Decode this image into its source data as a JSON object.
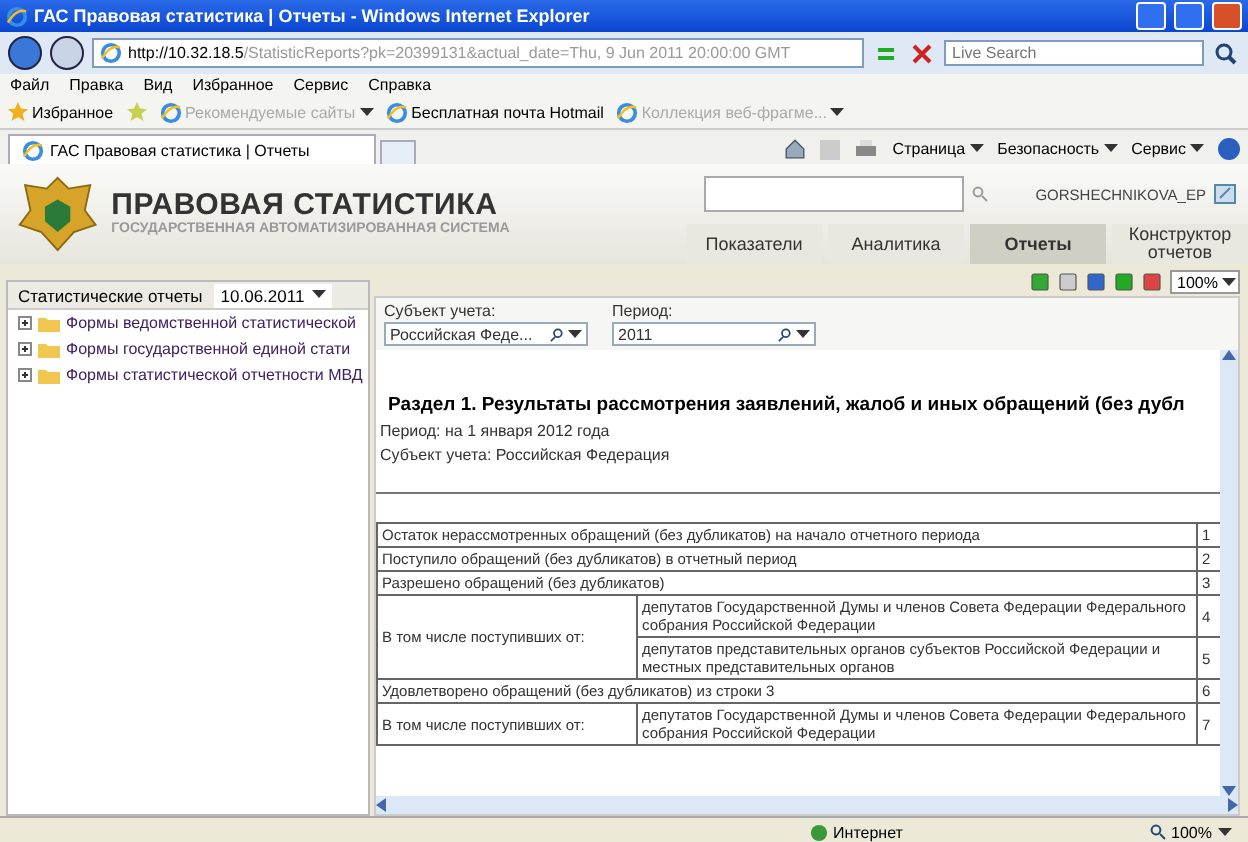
{
  "window": {
    "title": "ГАС Правовая статистика | Отчеты - Windows Internet Explorer"
  },
  "address_bar": {
    "host": "http://10.32.18.5",
    "path": "/StatisticReports?pk=20399131&actual_date=Thu, 9 Jun 2011 20:00:00 GMT"
  },
  "search": {
    "placeholder": "Live Search"
  },
  "menu": [
    "Файл",
    "Правка",
    "Вид",
    "Избранное",
    "Сервис",
    "Справка"
  ],
  "favorites_bar": {
    "label": "Избранное",
    "links": [
      {
        "label": "Рекомендуемые сайты",
        "disabled": true,
        "dropdown": true
      },
      {
        "label": "Бесплатная почта Hotmail",
        "disabled": false,
        "dropdown": false
      },
      {
        "label": "Коллекция веб-фрагме...",
        "disabled": true,
        "dropdown": true
      }
    ]
  },
  "browser_tabs": [
    {
      "label": "ГАС Правовая статистика | Отчеты",
      "selected": true
    }
  ],
  "command_bar": [
    "Страница",
    "Безопасность",
    "Сервис"
  ],
  "site_header": {
    "title": "ПРАВОВАЯ СТАТИСТИКА",
    "subtitle": "ГОСУДАРСТВЕННАЯ АВТОМАТИЗИРОВАННАЯ СИСТЕМА",
    "user": "GORSHECHNIKOVA_EP"
  },
  "nav_tabs": [
    {
      "label": "Показатели",
      "selected": false
    },
    {
      "label": "Аналитика",
      "selected": false
    },
    {
      "label": "Отчеты",
      "selected": true
    },
    {
      "label": "Конструктор отчетов",
      "selected": false
    }
  ],
  "sidebar": {
    "title": "Статистические отчеты",
    "date": "10.06.2011",
    "items": [
      {
        "label": "Формы ведомственной статистической",
        "expanded": false
      },
      {
        "label": "Формы государственной единой стати",
        "expanded": false
      },
      {
        "label": "Формы статистической отчетности МВД",
        "expanded": false
      }
    ]
  },
  "zoom": "100%",
  "filters": [
    {
      "label": "Субъект учета:",
      "value": "Российская Феде..."
    },
    {
      "label": "Период:",
      "value": "2011"
    }
  ],
  "report": {
    "title": "Раздел 1. Результаты рассмотрения заявлений, жалоб и иных обращений (без дубл",
    "period": "Период: на 1 января 2012 года",
    "subject": "Субъект учета: Российская Федерация",
    "rows": [
      {
        "kind": "single",
        "label": "Остаток нерассмотренных обращений (без дубликатов) на начало отчетного периода",
        "number": "1"
      },
      {
        "kind": "single",
        "label": "Поступило обращений (без дубликатов) в отчетный период",
        "number": "2"
      },
      {
        "kind": "single",
        "label": "Разрешено обращений (без дубликатов)",
        "number": "3"
      },
      {
        "kind": "group",
        "label": "В том числе поступивших от:",
        "items": [
          {
            "label": "депутатов Государственной Думы и членов Совета Федерации Федерального собрания Российской Федерации",
            "number": "4"
          },
          {
            "label": "депутатов представительных органов субъектов Российской Федерации и местных представительных органов",
            "number": "5"
          }
        ]
      },
      {
        "kind": "single",
        "label": "Удовлетворено обращений (без дубликатов) из строки 3",
        "number": "6"
      },
      {
        "kind": "group",
        "label": "В том числе поступивших от:",
        "items": [
          {
            "label": "депутатов Государственной Думы и членов Совета Федерации Федерального собрания Российской Федерации",
            "number": "7"
          }
        ]
      }
    ]
  },
  "status_bar": {
    "zone": "Интернет",
    "zoom": "100%"
  }
}
